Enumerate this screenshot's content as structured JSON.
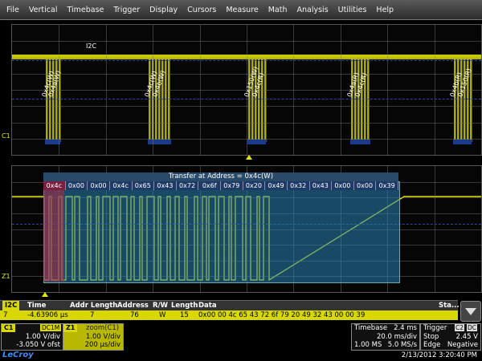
{
  "menu": [
    "File",
    "Vertical",
    "Timebase",
    "Trigger",
    "Display",
    "Cursors",
    "Measure",
    "Math",
    "Analysis",
    "Utilities",
    "Help"
  ],
  "grid1": {
    "label": "I2C",
    "channel_label": "C1",
    "packets": [
      "0x4c(W)",
      "0x4a(W)",
      "0x4c(W)",
      "0x4b(W)",
      "0x150(W)",
      "0x4c(R)",
      "0x4a(R)",
      "0x4c(R)",
      "0x4b(R)",
      "0x150(R)"
    ]
  },
  "grid2": {
    "channel_label": "Z1",
    "transfer_title": "Transfer at Address = 0x4c(W)",
    "cells": [
      "0x4c",
      "0x00",
      "0x00",
      "0x4c",
      "0x65",
      "0x43",
      "0x72",
      "0x6f",
      "0x79",
      "0x20",
      "0x49",
      "0x32",
      "0x43",
      "0x00",
      "0x00",
      "0x39"
    ]
  },
  "table": {
    "headers": {
      "proto": "I2C",
      "time": "Time",
      "addr_length": "Addr Length",
      "address": "Address",
      "rw": "R/W",
      "length": "Length",
      "data": "Data",
      "status": "Sta..."
    },
    "row": {
      "index": "7",
      "time": "-4.63906 µs",
      "addr_length": "7",
      "address": "76",
      "rw": "W",
      "length": "15",
      "data": "0x00 00 4c 65 43 72 6f 79 20 49 32 43 00 00 39"
    }
  },
  "c1": {
    "name": "C1",
    "coupling": "DC1M",
    "vdiv": "1.00 V/div",
    "offset": "-3.050 V ofst"
  },
  "z1": {
    "name": "Z1",
    "label": "zoom(C1)",
    "vdiv": "1.00 V/div",
    "tdiv": "200 µs/div"
  },
  "timebase": {
    "label": "Timebase",
    "delay": "2.4 ms",
    "tdiv": "20.0 ms/div",
    "samples": "1.00 MS",
    "rate": "5.0 MS/s"
  },
  "trigger": {
    "label": "Trigger",
    "ch": "C2",
    "coupling": "DC",
    "mode": "Stop",
    "level": "2.45 V",
    "type": "Edge",
    "slope": "Negative"
  },
  "footer": {
    "brand": "LeCroy",
    "datetime": "2/13/2012 3:20:40 PM"
  },
  "colors": {
    "trace": "#e6e600",
    "annotation": "#2882b4",
    "first_byte": "#b42846",
    "menubar": "#3a3a3a"
  }
}
